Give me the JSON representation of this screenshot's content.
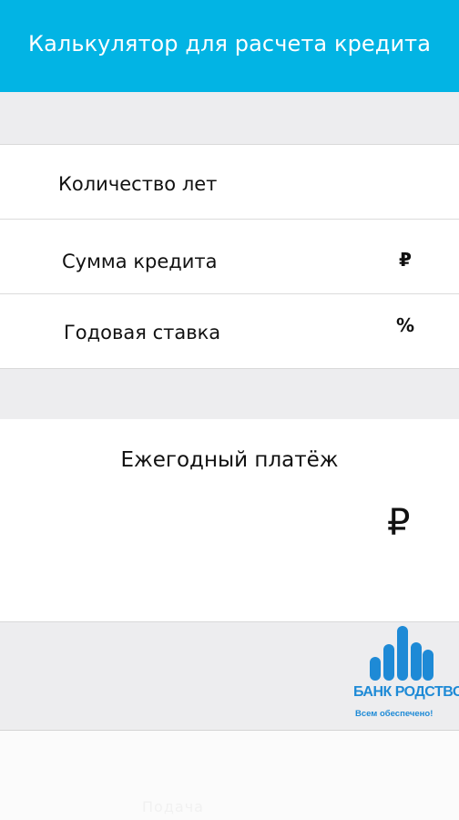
{
  "header": {
    "title": "Калькулятор для расчета кредита",
    "color": "#02b4e4"
  },
  "inputs": [
    {
      "label": "Количество лет",
      "value": "",
      "unit": ""
    },
    {
      "label": "Сумма кредита",
      "value": "",
      "unit": "₽"
    },
    {
      "label": "Годовая ставка",
      "value": "",
      "unit": "%"
    }
  ],
  "result": {
    "title": "Ежегодный платёж",
    "value": "",
    "currency": "₽"
  },
  "ad": {
    "brand": "БАНК РОДСТВО",
    "slogan": "Всем обеспечено!",
    "brand_color": "#1e8ad6",
    "icon": "bar-chart-logo-icon"
  },
  "bottom": {
    "faded_text": "Подача"
  }
}
